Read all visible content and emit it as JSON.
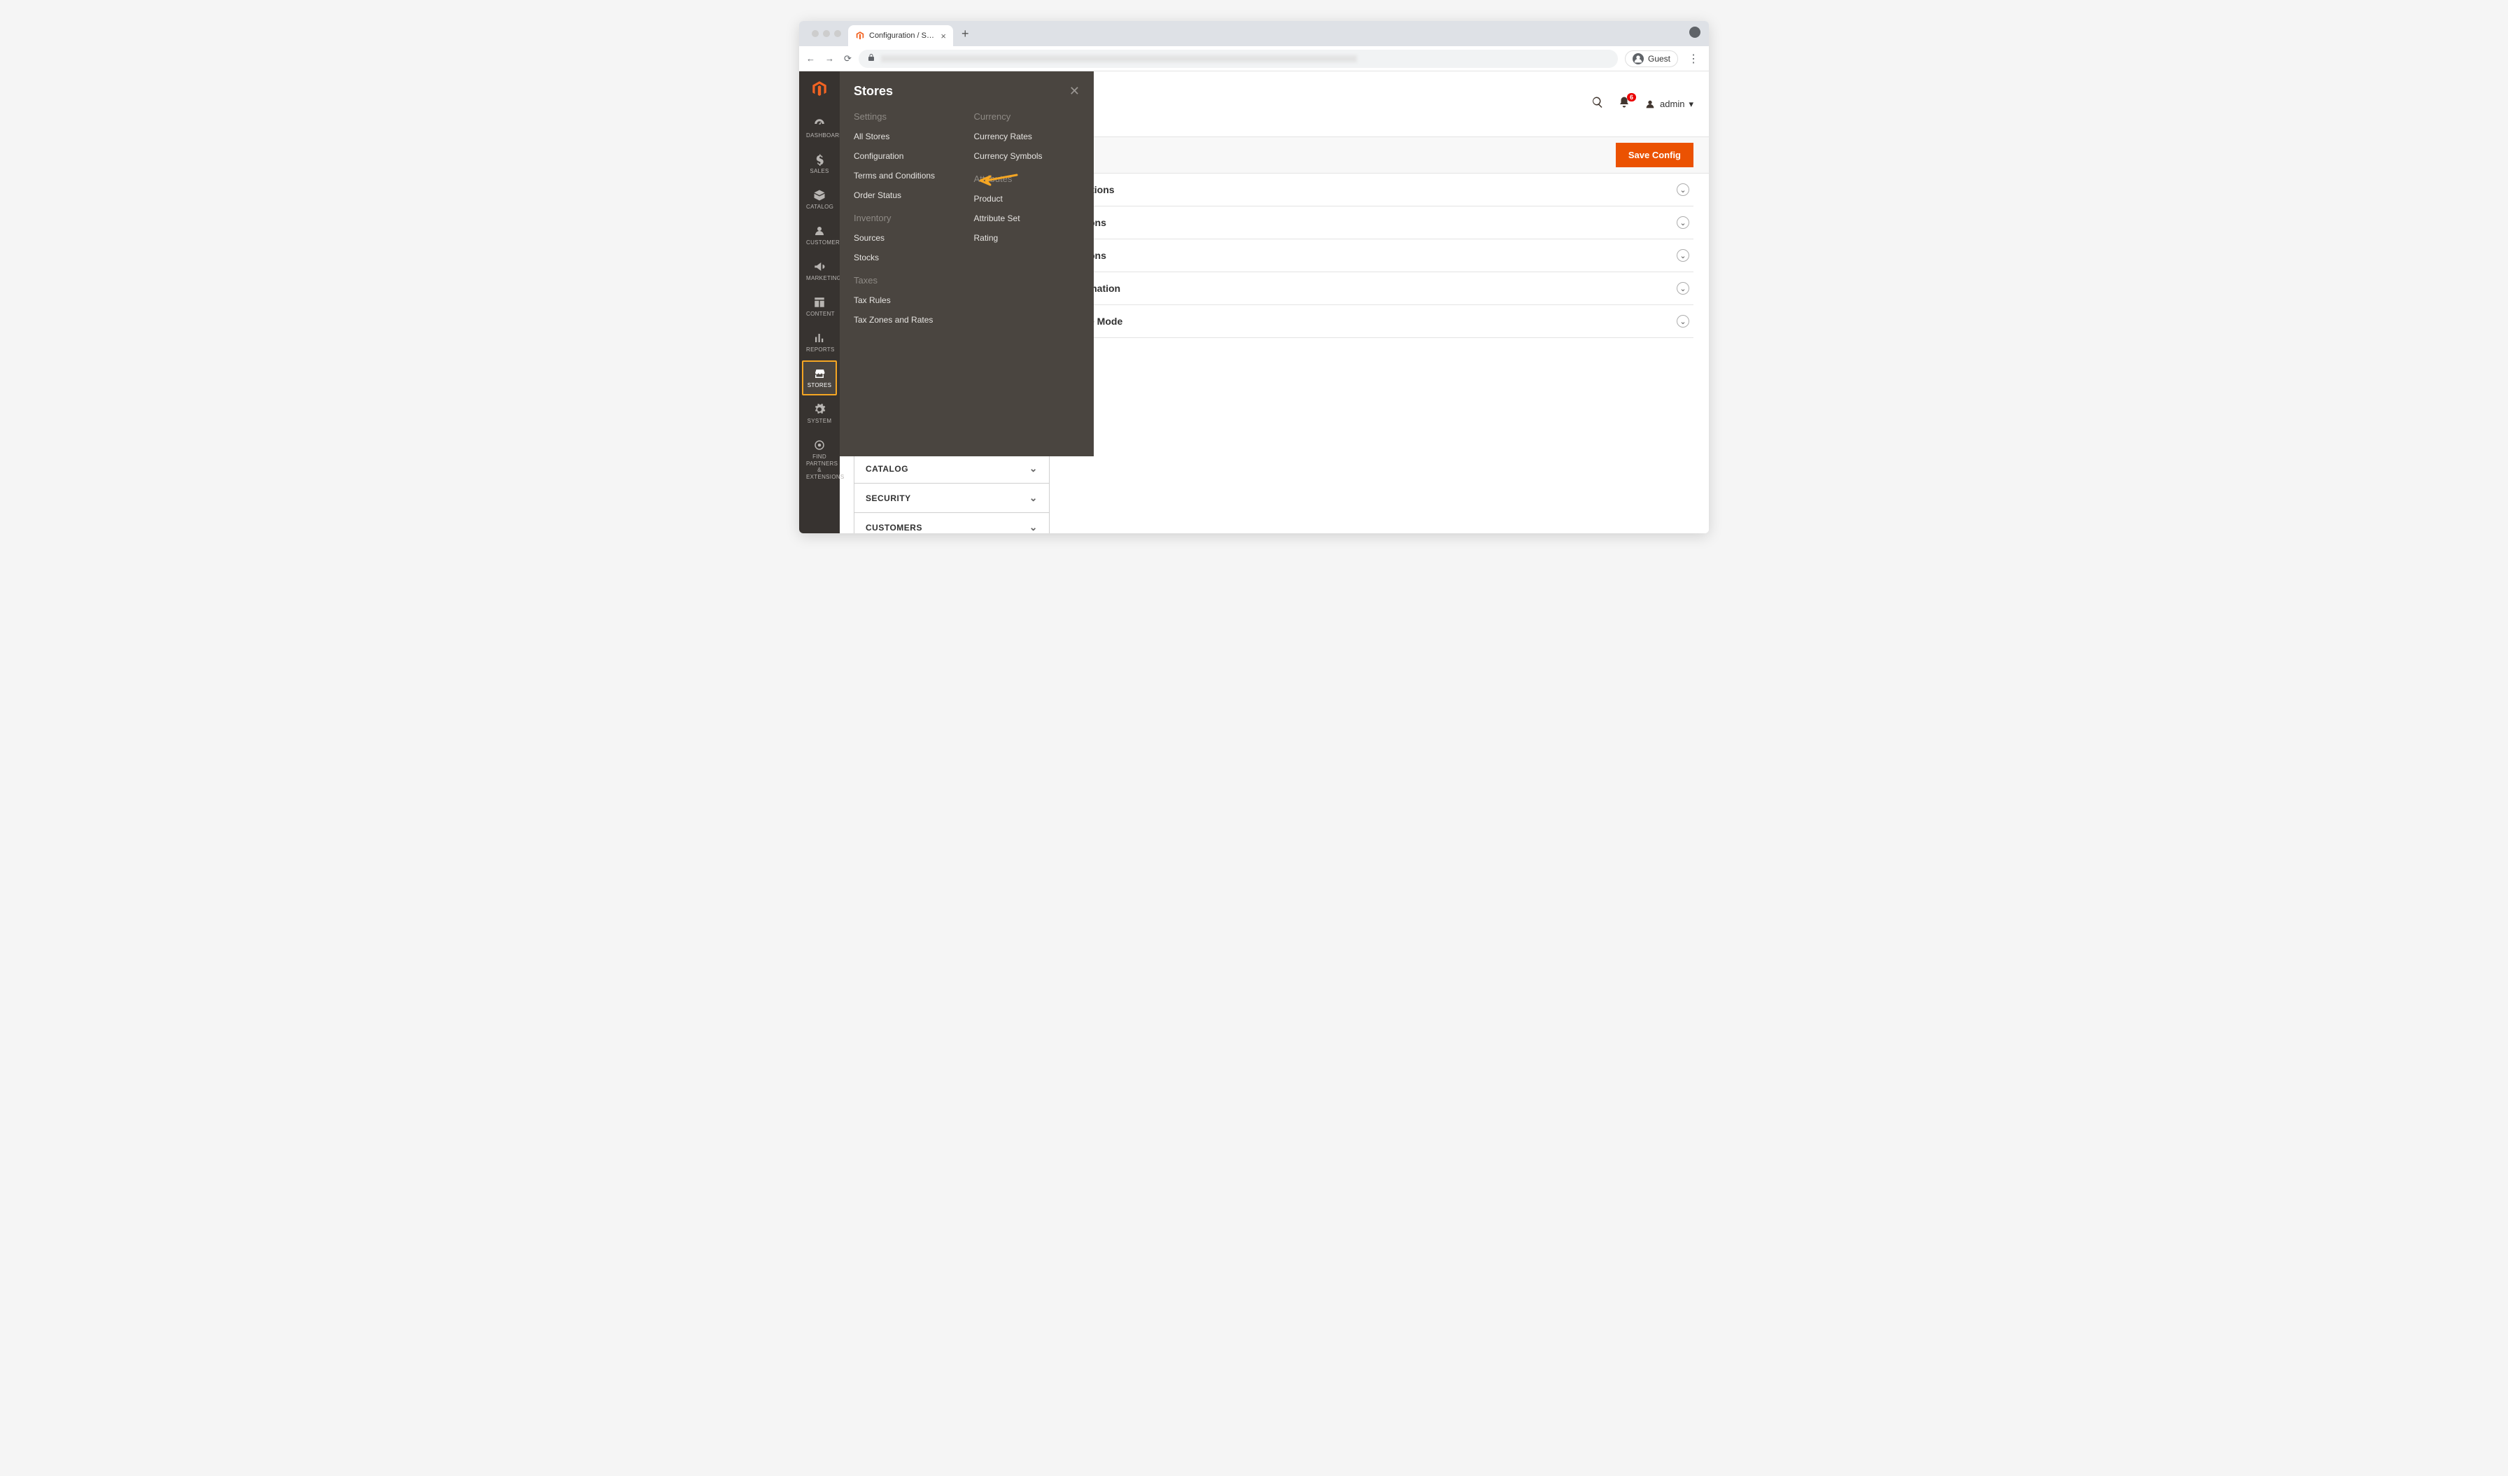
{
  "browser": {
    "tab_title": "Configuration / Settings / Store",
    "guest_label": "Guest",
    "lights": [
      "",
      "",
      ""
    ]
  },
  "rail": {
    "items": [
      {
        "label": "DASHBOARD"
      },
      {
        "label": "SALES"
      },
      {
        "label": "CATALOG"
      },
      {
        "label": "CUSTOMERS"
      },
      {
        "label": "MARKETING"
      },
      {
        "label": "CONTENT"
      },
      {
        "label": "REPORTS"
      },
      {
        "label": "STORES"
      },
      {
        "label": "SYSTEM"
      },
      {
        "label": "FIND PARTNERS & EXTENSIONS"
      }
    ]
  },
  "flyout": {
    "title": "Stores",
    "groups_left": [
      {
        "title": "Settings",
        "links": [
          "All Stores",
          "Configuration",
          "Terms and Conditions",
          "Order Status"
        ]
      },
      {
        "title": "Inventory",
        "links": [
          "Sources",
          "Stocks"
        ]
      },
      {
        "title": "Taxes",
        "links": [
          "Tax Rules",
          "Tax Zones and Rates"
        ]
      }
    ],
    "groups_right": [
      {
        "title": "Currency",
        "links": [
          "Currency Rates",
          "Currency Symbols"
        ]
      },
      {
        "title": "Attributes",
        "links": [
          "Product",
          "Attribute Set",
          "Rating"
        ]
      }
    ]
  },
  "header": {
    "notifications_count": "6",
    "user_label": "admin"
  },
  "toolbar": {
    "save_label": "Save Config"
  },
  "accordions": [
    "y Options",
    "Options",
    "Options",
    "nformation",
    "Store Mode"
  ],
  "config_sidebar": [
    "CATALOG",
    "SECURITY",
    "CUSTOMERS"
  ]
}
